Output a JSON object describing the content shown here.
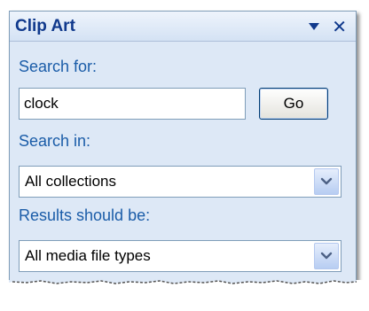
{
  "panel": {
    "title": "Clip Art"
  },
  "search": {
    "label": "Search for:",
    "value": "clock",
    "go_label": "Go"
  },
  "search_in": {
    "label": "Search in:",
    "selected": "All collections"
  },
  "results": {
    "label": "Results should be:",
    "selected": "All media file types"
  },
  "icons": {
    "title_menu": "dropdown-arrow-icon",
    "title_close": "close-icon",
    "select_arrow": "chevron-down-icon"
  },
  "colors": {
    "panel_bg": "#dde8f6",
    "title_text": "#10398c",
    "label_text": "#1a5ca8",
    "border": "#7f9db9"
  }
}
